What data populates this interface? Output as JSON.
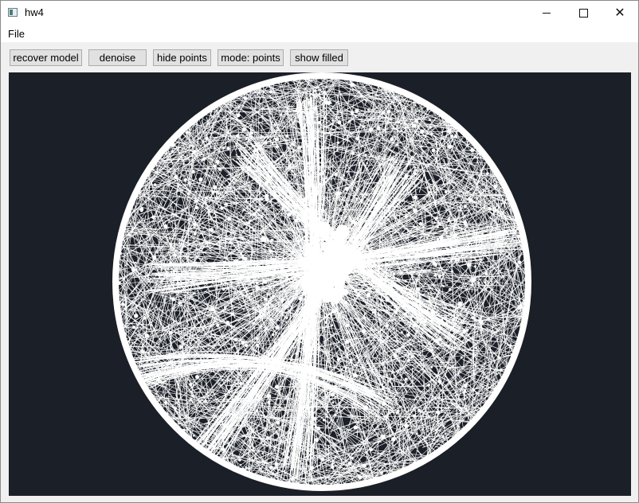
{
  "window": {
    "title": "hw4",
    "controls": {
      "minimize": "minimize",
      "maximize": "maximize",
      "close": "close"
    }
  },
  "menu": {
    "items": [
      "File"
    ]
  },
  "toolbar": {
    "buttons": [
      "recover model",
      "denoise",
      "hide points",
      "mode: points",
      "show filled"
    ]
  },
  "viewport": {
    "background": "#1b1f27",
    "stroke_color": "#ffffff",
    "content": "dense white line mesh inside circle"
  },
  "colors": {
    "titlebar": "#ffffff",
    "window_bg": "#f0f0f0",
    "button_bg": "#e1e1e1",
    "button_border": "#adadad"
  }
}
